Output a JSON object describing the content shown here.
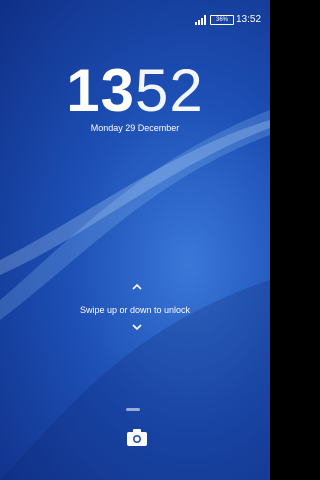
{
  "status_bar": {
    "battery_label": "36%",
    "time": "13:52",
    "signal_icon": "signal-icon",
    "battery_icon": "battery-icon"
  },
  "lock_clock": {
    "hours": "13",
    "minutes": "52",
    "date": "Monday 29 December"
  },
  "unlock": {
    "hint": "Swipe up or down to unlock",
    "up_icon": "chevron-up-icon",
    "down_icon": "chevron-down-icon"
  },
  "shortcuts": {
    "camera_icon": "camera-icon"
  },
  "colors": {
    "wallpaper": "#1d4fb5",
    "text": "#ffffff"
  }
}
